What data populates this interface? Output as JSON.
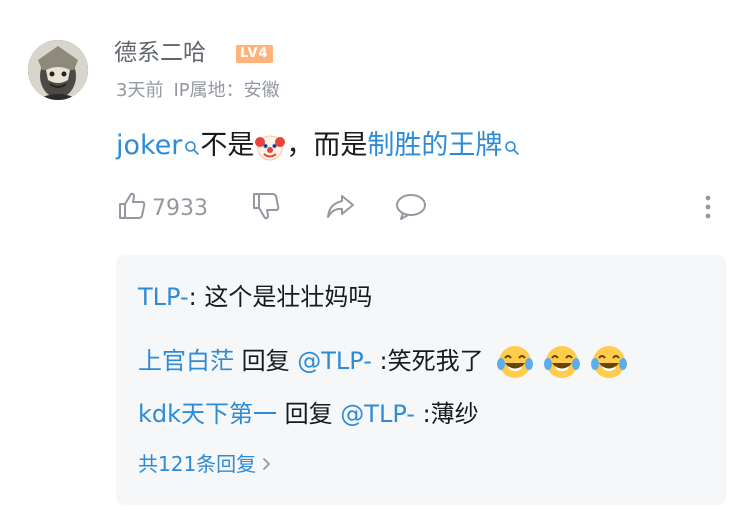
{
  "comment": {
    "username": "德系二哈",
    "level": "LV4",
    "time": "3天前",
    "ip_location": "IP属地：安徽",
    "content": {
      "link1": "joker",
      "text1": "不是",
      "text2": "，而是",
      "link2": "制胜的王牌"
    },
    "like_count": "7933"
  },
  "replies": {
    "items": [
      {
        "user": "TLP-",
        "sep": ": ",
        "text": "这个是壮壮妈吗"
      },
      {
        "user": "上官白茫",
        "reply_word": " 回复 ",
        "mention": "@TLP-",
        "sep": " :",
        "text": "笑死我了"
      },
      {
        "user": "kdk天下第一",
        "reply_word": " 回复 ",
        "mention": "@TLP-",
        "sep": " :",
        "text": "薄纱"
      }
    ],
    "more_label": "共121条回复"
  },
  "colors": {
    "link": "#2e8bd7",
    "muted": "#9499a0",
    "level_bg": "#ffb27a",
    "reply_bg": "#f6f7f8"
  },
  "icons": [
    "thumbs-up-icon",
    "thumbs-down-icon",
    "share-icon",
    "comment-icon",
    "more-vertical-icon",
    "search-icon",
    "clown-emoji",
    "laughing-emoji"
  ]
}
